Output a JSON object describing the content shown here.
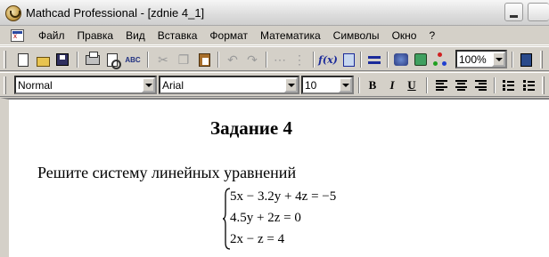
{
  "window": {
    "title": "Mathcad Professional - [zdnie 4_1]"
  },
  "menu": {
    "items": [
      "Файл",
      "Правка",
      "Вид",
      "Вставка",
      "Формат",
      "Математика",
      "Символы",
      "Окно",
      "?"
    ]
  },
  "toolbar": {
    "zoom": "100%"
  },
  "format_bar": {
    "style": "Normal",
    "font": "Arial",
    "size": "10",
    "bold_label": "B",
    "italic_label": "I",
    "underline_label": "U"
  },
  "document": {
    "heading": "Задание 4",
    "instruction": "Решите систему линейных уравнений",
    "equations": [
      "5x − 3.2y + 4z = −5",
      "4.5y + 2z = 0",
      "2x − z = 4"
    ]
  },
  "icons": [
    "new-document-icon",
    "open-folder-icon",
    "save-icon",
    "print-icon",
    "print-preview-icon",
    "spell-check-icon",
    "cut-icon",
    "copy-icon",
    "paste-icon",
    "undo-icon",
    "redo-icon",
    "align-across-icon",
    "align-down-icon",
    "insert-function-icon",
    "insert-unit-icon",
    "calculate-icon",
    "resources-icon",
    "component-icon",
    "distribution-icon",
    "e-book-icon",
    "align-left-icon",
    "align-center-icon",
    "align-right-icon",
    "bullet-list-icon",
    "numbered-list-icon"
  ],
  "colors": {
    "background": "#d4d0c8",
    "worksheet": "#ffffff",
    "accent": "#1a2a9a"
  }
}
